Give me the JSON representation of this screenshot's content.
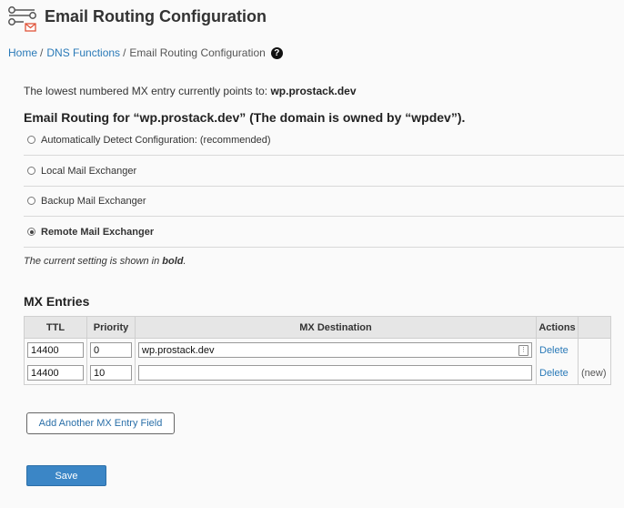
{
  "page": {
    "title": "Email Routing Configuration"
  },
  "breadcrumb": {
    "items": [
      "Home",
      "DNS Functions"
    ],
    "current": "Email Routing Configuration"
  },
  "mx_note": {
    "text": "The lowest numbered MX entry currently points to:",
    "domain": "wp.prostack.dev"
  },
  "routing": {
    "heading": "Email Routing for “wp.prostack.dev” (The domain is owned by “wpdev”).",
    "options": [
      {
        "label": "Automatically Detect Configuration: (recommended)",
        "checked": false
      },
      {
        "label": "Local Mail Exchanger",
        "checked": false
      },
      {
        "label": "Backup Mail Exchanger",
        "checked": false
      },
      {
        "label": "Remote Mail Exchanger",
        "checked": true
      }
    ],
    "current_note_prefix": "The current setting is shown in",
    "current_note_bold": "bold",
    "current_note_suffix": "."
  },
  "mx_entries": {
    "heading": "MX Entries",
    "columns": [
      "TTL",
      "Priority",
      "MX Destination",
      "Actions"
    ],
    "rows": [
      {
        "ttl": "14400",
        "priority": "0",
        "destination": "wp.prostack.dev",
        "action": "Delete",
        "tag": ""
      },
      {
        "ttl": "14400",
        "priority": "10",
        "destination": "",
        "action": "Delete",
        "tag": "(new)"
      }
    ]
  },
  "buttons": {
    "add_field": "Add Another MX Entry Field",
    "save": "Save"
  },
  "colors": {
    "link": "#2a7ab8",
    "save_button": "#3b86c6",
    "table_header": "#e6e6e6"
  },
  "icons": {
    "title": "routing-envelope-icon",
    "help": "question-circle-icon"
  }
}
